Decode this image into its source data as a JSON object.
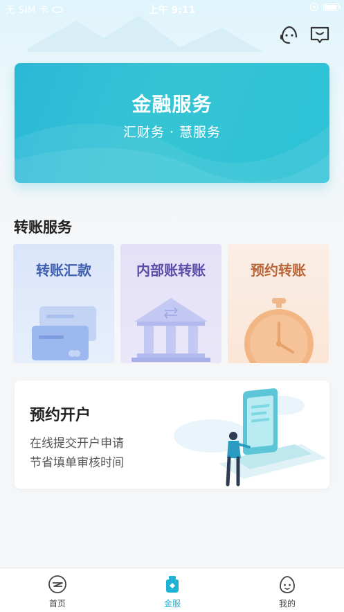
{
  "status_bar": {
    "carrier": "无 SIM 卡",
    "time": "上午 9:11"
  },
  "header": {
    "service_icon": "customer-service-icon",
    "message_icon": "message-icon"
  },
  "banner": {
    "title": "金融服务",
    "subtitle": "汇财务 · 慧服务"
  },
  "transfer_section": {
    "title": "转账服务",
    "cards": [
      {
        "label": "转账汇款",
        "icon": "bank-cards-icon"
      },
      {
        "label": "内部账转账",
        "icon": "bank-building-icon"
      },
      {
        "label": "预约转账",
        "icon": "stopwatch-icon"
      }
    ]
  },
  "appointment": {
    "title": "预约开户",
    "line1": "在线提交开户申请",
    "line2": "节省填单审核时间"
  },
  "tabbar": {
    "items": [
      {
        "label": "首页",
        "icon": "home-logo-icon",
        "active": false
      },
      {
        "label": "金服",
        "icon": "financial-service-icon",
        "active": true
      },
      {
        "label": "我的",
        "icon": "profile-face-icon",
        "active": false
      }
    ]
  },
  "colors": {
    "accent": "#2ab8d7",
    "active_tab": "#1fb2d4"
  }
}
